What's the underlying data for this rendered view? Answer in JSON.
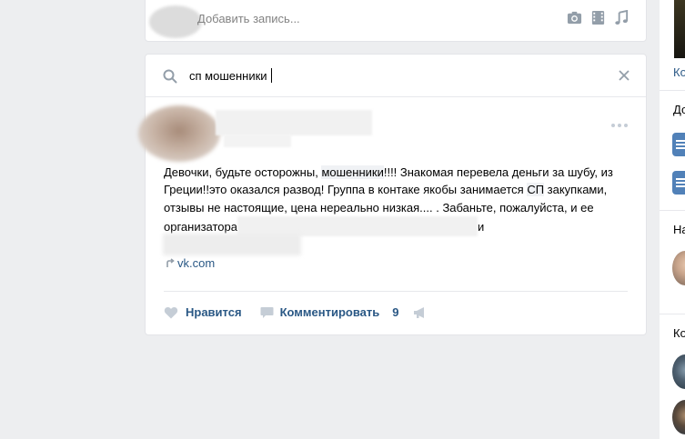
{
  "composer": {
    "placeholder": "Добавить запись...",
    "icons": [
      "camera-icon",
      "video-icon",
      "music-icon"
    ]
  },
  "search": {
    "value": "сп мошенники"
  },
  "post": {
    "text_before_hl1": "Девочки, будьте осторожны, ",
    "highlight1": "мошенники",
    "text_mid1": "!!!! Знакомая перевела деньги за шубу, из Греции!!это оказался развод! Группа в контаке якобы занимается ",
    "highlight2": "СП",
    "text_mid2": " закупками, отзывы не настоящие, цена нереально низкая.... . Забаньте, пожалуйста, и ее организатора",
    "text_after_blur": "и",
    "link": "vk.com"
  },
  "actions": {
    "like_label": "Нравится",
    "comment_label": "Комментировать",
    "comment_count": "9"
  },
  "right_column": {
    "link1": "Ко",
    "heading1": "До",
    "heading2": "На",
    "heading3": "Ко"
  },
  "colors": {
    "background": "#edeef0",
    "link": "#2a5885",
    "icon": "#939ea9",
    "accent": "#5181b8"
  }
}
